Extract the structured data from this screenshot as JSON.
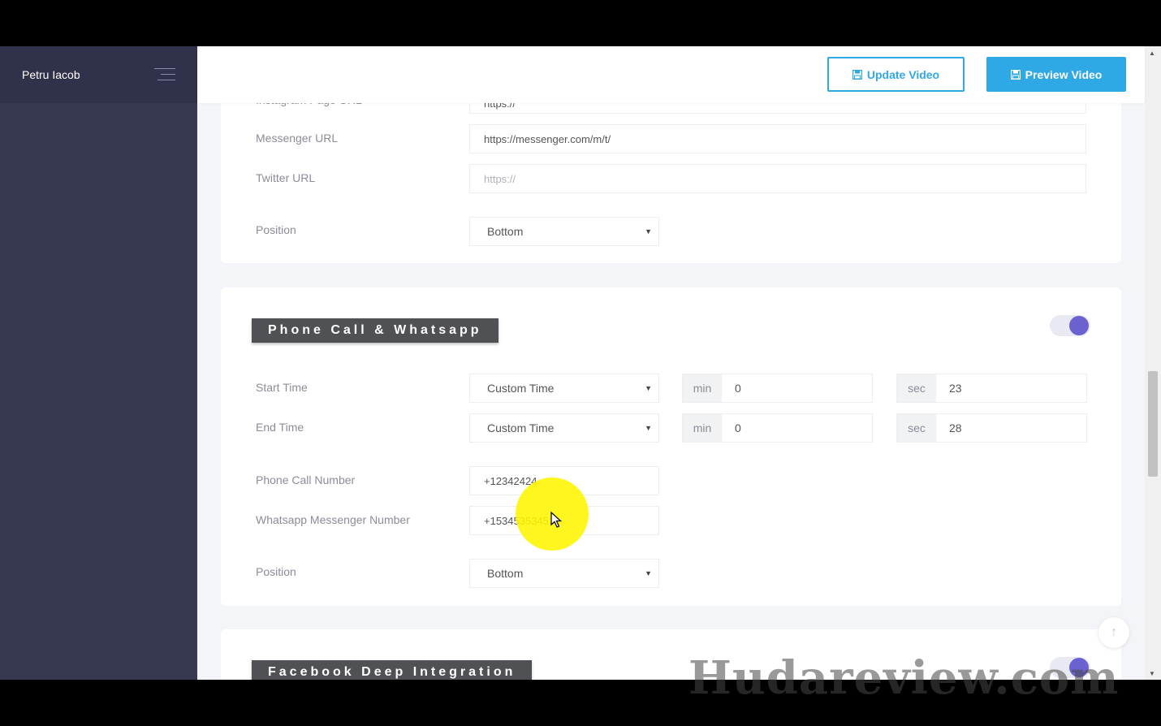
{
  "sidebar": {
    "user_name": "Petru Iacob"
  },
  "toolbar": {
    "update_label": "Update Video",
    "preview_label": "Preview Video"
  },
  "social_section": {
    "partial_label": "Instagram Page URL",
    "partial_value": "https://",
    "messenger_label": "Messenger URL",
    "messenger_value": "https://messenger.com/m/t/",
    "twitter_label": "Twitter URL",
    "twitter_placeholder": "https://",
    "position_label": "Position",
    "position_value": "Bottom"
  },
  "phone_section": {
    "title": "Phone Call & Whatsapp",
    "start_time_label": "Start Time",
    "start_time_value": "Custom Time",
    "start_min_prefix": "min",
    "start_min_value": "0",
    "start_sec_prefix": "sec",
    "start_sec_value": "23",
    "end_time_label": "End Time",
    "end_time_value": "Custom Time",
    "end_min_prefix": "min",
    "end_min_value": "0",
    "end_sec_prefix": "sec",
    "end_sec_value": "28",
    "phone_label": "Phone Call Number",
    "phone_value": "+12342424",
    "whatsapp_label": "Whatsapp Messenger Number",
    "whatsapp_value": "+15345353453",
    "position_label": "Position",
    "position_value": "Bottom",
    "toggle_on": true
  },
  "facebook_section": {
    "title": "Facebook Deep Integration",
    "toggle_on": true
  },
  "watermark": "Hudareview.com",
  "colors": {
    "accent": "#2fa8e6",
    "toggle": "#6b62cf",
    "sidebar": "#373851",
    "title_bg": "#505155"
  }
}
